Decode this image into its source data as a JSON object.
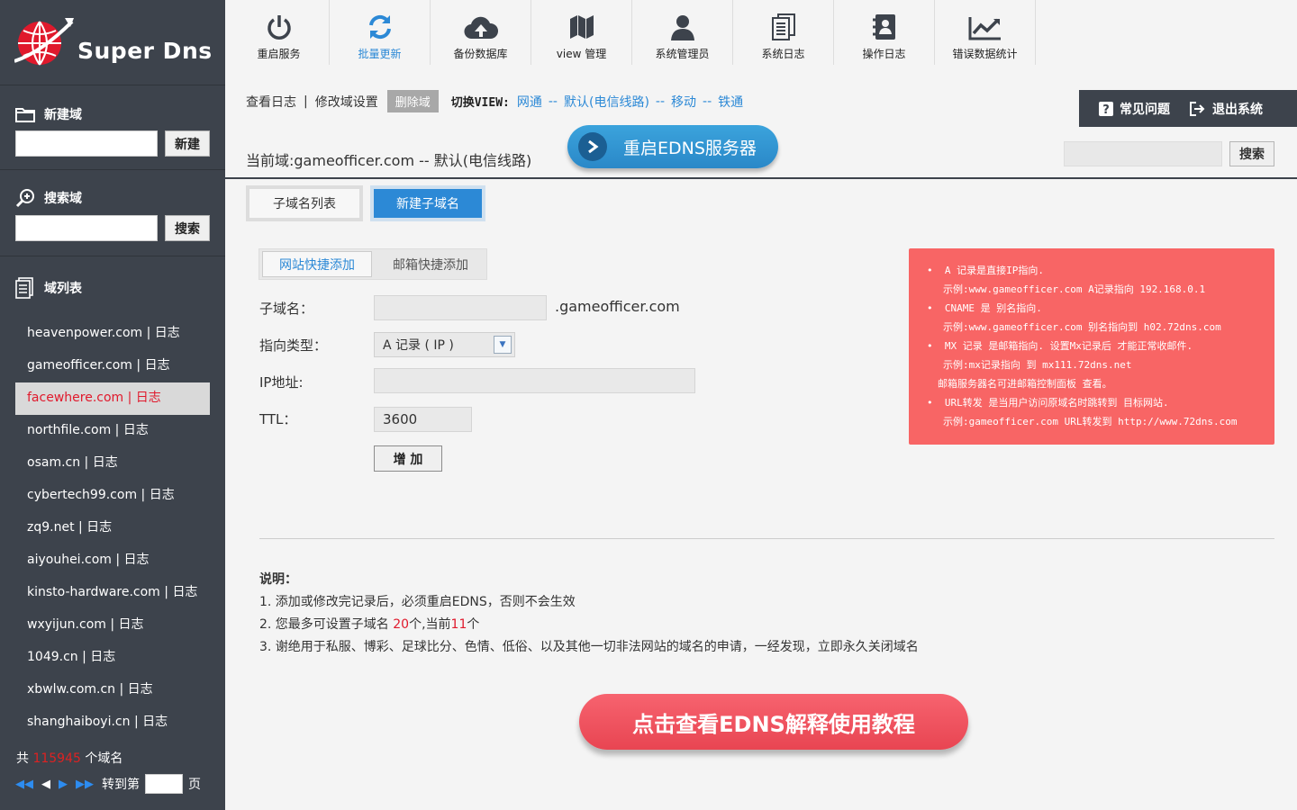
{
  "logo": {
    "text": "Super Dns"
  },
  "sidebar": {
    "new_domain": {
      "title": "新建域",
      "button": "新建"
    },
    "search_domain": {
      "title": "搜索域",
      "button": "搜索"
    },
    "domain_list_title": "域列表",
    "domains": [
      "heavenpower.com | 日志",
      "gameofficer.com | 日志",
      "facewhere.com | 日志",
      "northfile.com | 日志",
      "osam.cn | 日志",
      "cybertech99.com | 日志",
      "zq9.net | 日志",
      "aiyouhei.com | 日志",
      "kinsto-hardware.com | 日志",
      "wxyijun.com | 日志",
      "1049.cn | 日志",
      "xbwlw.com.cn | 日志",
      "shanghaiboyi.cn | 日志"
    ],
    "active_domain_index": 2,
    "count_prefix": "共",
    "count": "115945",
    "count_suffix": "个域名",
    "goto_label": "转到第",
    "page_label": "页"
  },
  "toolbar": [
    {
      "label": "重启服务",
      "icon": "power-icon"
    },
    {
      "label": "批量更新",
      "icon": "refresh-icon"
    },
    {
      "label": "备份数据库",
      "icon": "cloud-upload-icon"
    },
    {
      "label": "view 管理",
      "icon": "map-icon"
    },
    {
      "label": "系统管理员",
      "icon": "user-icon"
    },
    {
      "label": "系统日志",
      "icon": "document-icon"
    },
    {
      "label": "操作日志",
      "icon": "address-book-icon"
    },
    {
      "label": "错误数据统计",
      "icon": "line-chart-icon"
    }
  ],
  "subnav": {
    "view_log": "查看日志",
    "sep": "|",
    "modify": "修改域设置",
    "delete": "删除域",
    "switch_label": "切换VIEW:",
    "views": [
      "网通",
      "默认(电信线路)",
      "移动",
      "铁通"
    ],
    "dash": "--"
  },
  "current_domain": "当前域:gameofficer.com -- 默认(电信线路)",
  "restart_edns": "重启EDNS服务器",
  "help": {
    "faq": "常见问题",
    "logout": "退出系统"
  },
  "top_search": {
    "button": "搜索"
  },
  "tabs": {
    "list": "子域名列表",
    "new": "新建子域名"
  },
  "subtabs": {
    "website": "网站快捷添加",
    "mail": "邮箱快捷添加"
  },
  "form": {
    "subdomain_label": "子域名：",
    "suffix": ".gameofficer.com",
    "type_label": "指向类型：",
    "type_value": "A 记录 ( IP )",
    "ip_label": "IP地址:",
    "ttl_label": "TTL：",
    "ttl_value": "3600",
    "add_button": "增 加"
  },
  "notes": [
    "A 记录是直接IP指向.",
    "示例:www.gameofficer.com A记录指向 192.168.0.1",
    "CNAME 是 别名指向.",
    "示例:www.gameofficer.com 别名指向到 h02.72dns.com",
    "MX 记录 是邮箱指向. 设置Mx记录后 才能正常收邮件.",
    "示例:mx记录指向 到 mx111.72dns.net",
    "邮箱服务器名可进邮箱控制面板 查看。",
    "URL转发 是当用户访问原域名时跳转到 目标网站.",
    "示例:gameofficer.com URL转发到 http://www.72dns.com"
  ],
  "explain": {
    "title": "说明：",
    "line1": "1. 添加或修改完记录后，必须重启EDNS，否则不会生效",
    "line2_a": "2. 您最多可设置子域名 ",
    "line2_max": "20",
    "line2_b": "个,当前",
    "line2_cur": "11",
    "line2_c": "个",
    "line3": "3. 谢绝用于私服、博彩、足球比分、色情、低俗、以及其他一切非法网站的域名的申请，一经发现，立即永久关闭域名"
  },
  "tutorial_button": "点击查看EDNS解释使用教程",
  "colors": {
    "sidebar": "#3d434c",
    "accent": "#2c89d6",
    "red": "#e0192c",
    "note_bg": "#f86565"
  }
}
